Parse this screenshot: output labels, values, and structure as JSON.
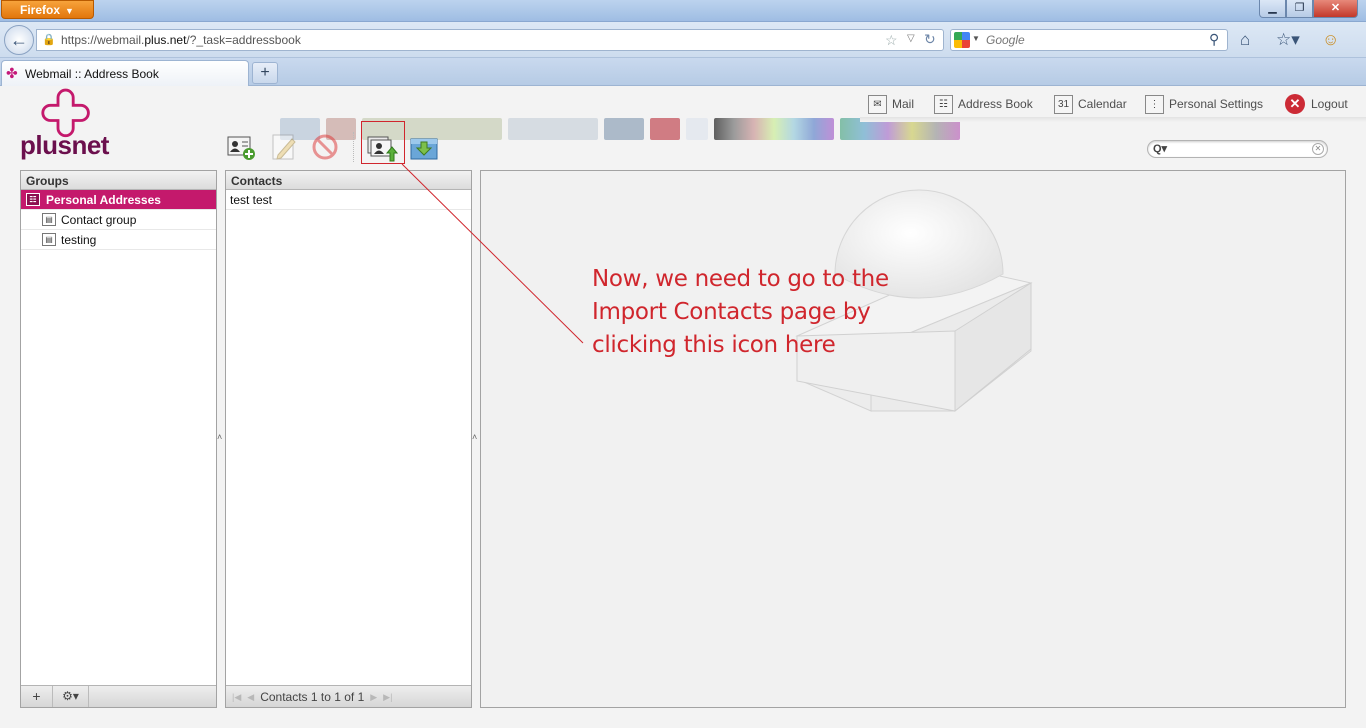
{
  "browser": {
    "menu_label": "Firefox",
    "url_prefix": "https://webmail.",
    "url_domain": "plus.net",
    "url_suffix": "/?_task=addressbook",
    "search_placeholder": "Google",
    "tab_title": "Webmail :: Address Book",
    "new_tab_label": "+"
  },
  "app": {
    "logo_text": "plusnet",
    "brand_color": "#c4196c",
    "topnav": [
      {
        "label": "Mail",
        "icon": "mail-icon"
      },
      {
        "label": "Address Book",
        "icon": "address-book-icon"
      },
      {
        "label": "Calendar",
        "icon": "calendar-icon"
      },
      {
        "label": "Personal Settings",
        "icon": "settings-icon"
      },
      {
        "label": "Logout",
        "icon": "logout-icon"
      }
    ],
    "calendar_icon_text": "31",
    "toolbar": [
      {
        "icon": "add-contact-icon"
      },
      {
        "icon": "edit-contact-icon"
      },
      {
        "icon": "delete-contact-icon"
      },
      {
        "icon": "import-contacts-icon"
      },
      {
        "icon": "export-contacts-icon"
      }
    ]
  },
  "groups": {
    "header": "Groups",
    "items": [
      {
        "label": "Personal Addresses",
        "selected": true
      },
      {
        "label": "Contact group",
        "selected": false
      },
      {
        "label": "testing",
        "selected": false
      }
    ],
    "footer_add": "+",
    "footer_actions": "⚙▾"
  },
  "contacts": {
    "header": "Contacts",
    "items": [
      "test test"
    ],
    "pager_text": "Contacts 1 to 1 of 1"
  },
  "annotation": {
    "text": "Now, we need to go to the Import Contacts page by clicking this icon here",
    "color": "#d0262d"
  }
}
